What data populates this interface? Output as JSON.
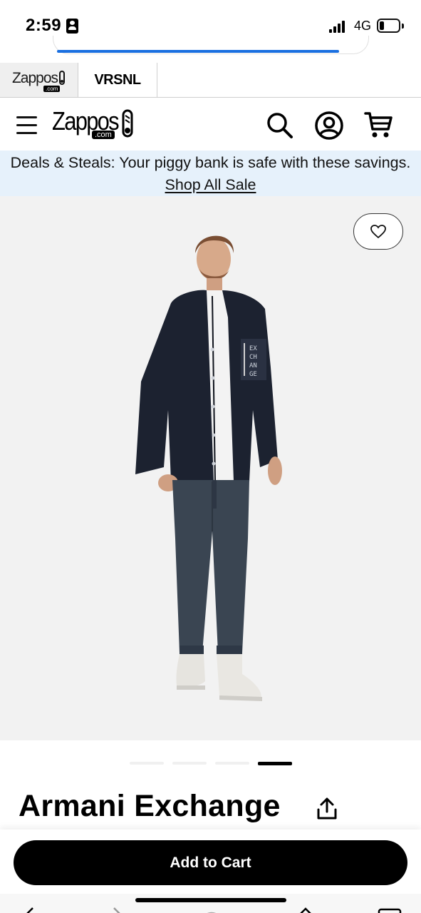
{
  "status_bar": {
    "time": "2:59",
    "network": "4G",
    "battery_level": 0.25
  },
  "browser": {
    "load_progress": 0.9
  },
  "brand_tabs": [
    {
      "label": "Zappos",
      "sub": ".com",
      "active": true
    },
    {
      "label": "VRSNL",
      "active": false
    }
  ],
  "header": {
    "logo_text": "Zappos",
    "logo_sub": ".com",
    "icons": [
      "menu-icon",
      "search-icon",
      "account-icon",
      "cart-icon"
    ]
  },
  "promo": {
    "text": "Deals & Steals: Your piggy bank is safe with these savings.",
    "link_label": "Shop All Sale"
  },
  "gallery": {
    "image_count": 4,
    "active_index": 3,
    "favorite_icon": "heart-icon",
    "pocket_text": [
      "EX",
      "CH",
      "AN",
      "GE"
    ]
  },
  "product": {
    "brand": "Armani Exchange"
  },
  "cart_bar": {
    "add_to_cart_label": "Add to Cart"
  },
  "colors": {
    "accent": "#000000",
    "promo_bg": "#e6f1fb",
    "progress": "#1a6fe0"
  }
}
